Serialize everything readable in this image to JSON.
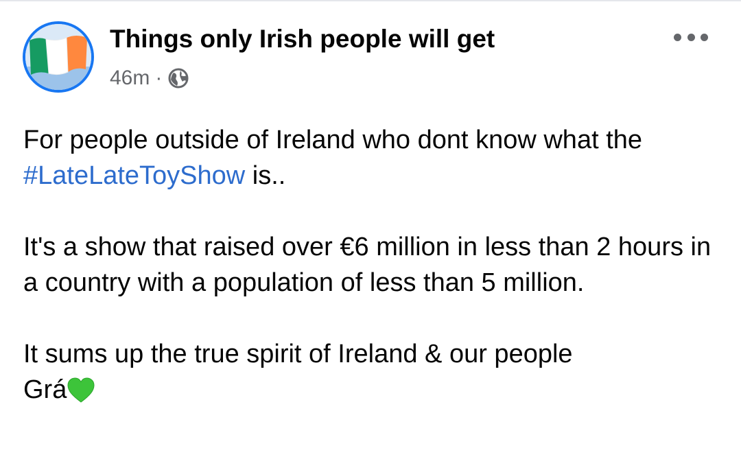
{
  "post": {
    "page_name": "Things only Irish people will get",
    "timestamp": "46m",
    "separator": "·",
    "audience_icon": "globe-icon",
    "more_icon": "more-options-icon",
    "avatar_icon": "irish-flag-icon",
    "body": {
      "p1_text": "For people outside of Ireland who dont know what the",
      "hashtag": "#LateLateToyShow",
      "p1_tail": " is..",
      "p2_text": "It's a show that raised over €6 million in less than 2 hours in a country with a population of less than 5 million.",
      "p3_text": "It sums up the true spirit of Ireland & our people",
      "p3_line2": "Grá",
      "emoji": "green-heart-icon"
    }
  },
  "colors": {
    "hashtag": "#2d6ccd",
    "secondary_text": "#65676b",
    "avatar_ring": "#1877f2",
    "flag_green": "#169b62",
    "flag_white": "#ffffff",
    "flag_orange": "#ff883e",
    "heart_green": "#3dc43a"
  }
}
